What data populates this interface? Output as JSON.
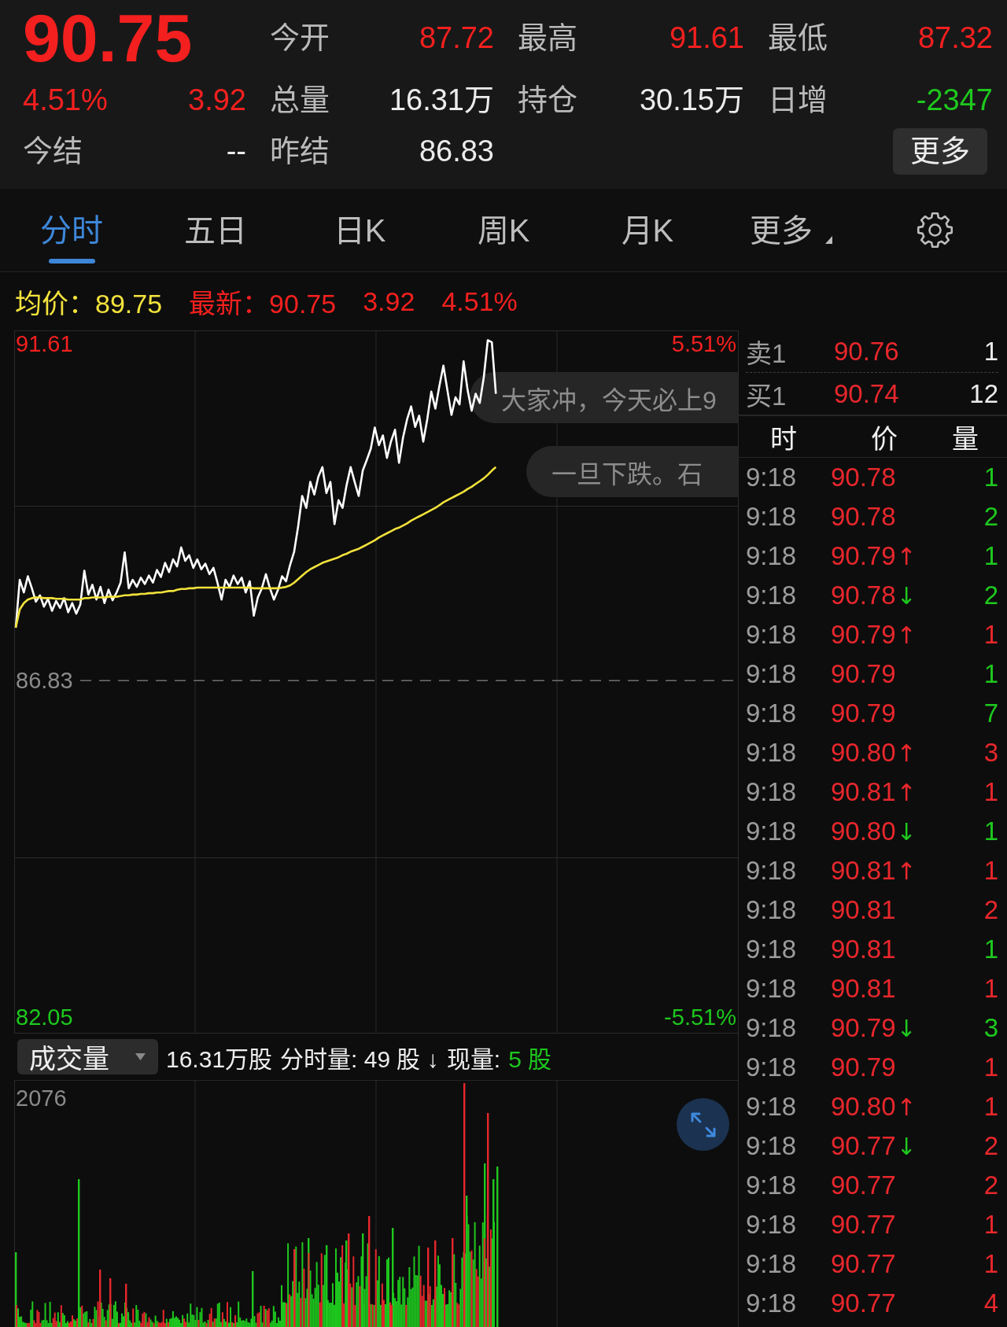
{
  "header": {
    "price": "90.75",
    "change_percent": "4.51%",
    "change": "3.92",
    "settle": {
      "label": "今结",
      "value": "--"
    },
    "stats": [
      {
        "label": "今开",
        "value": "87.72",
        "color": "#f3201f"
      },
      {
        "label": "最高",
        "value": "91.61",
        "color": "#f3201f"
      },
      {
        "label": "最低",
        "value": "87.32",
        "color": "#f3201f"
      },
      {
        "label": "总量",
        "value": "16.31万",
        "color": "#ececec"
      },
      {
        "label": "持仓",
        "value": "30.15万",
        "color": "#ececec"
      },
      {
        "label": "日增",
        "value": "-2347",
        "color": "#1ec81e"
      },
      {
        "label": "昨结",
        "value": "86.83",
        "color": "#ececec"
      }
    ],
    "more_button": "更多"
  },
  "tabs": [
    {
      "label": "分时",
      "selected": true,
      "kind": "tab"
    },
    {
      "label": "五日",
      "selected": false,
      "kind": "tab"
    },
    {
      "label": "日K",
      "selected": false,
      "kind": "tab"
    },
    {
      "label": "周K",
      "selected": false,
      "kind": "tab"
    },
    {
      "label": "月K",
      "selected": false,
      "kind": "tab"
    },
    {
      "label": "更多",
      "selected": false,
      "kind": "menu"
    }
  ],
  "legend": {
    "average": "均价：89.75",
    "latest": "最新：90.75",
    "change": "3.92",
    "change_percent": "4.51%"
  },
  "chart": {
    "percent_labels": [
      "5.51%",
      "-5.51%"
    ],
    "comments": [
      "大家冲，今天必上9",
      "一旦下跌。石"
    ],
    "chart_data": {
      "type": "line",
      "ylim": [
        81.82,
        91.8
      ],
      "yticks": [
        {
          "value": 91.61,
          "label": "91.61"
        },
        {
          "value": 82.05,
          "label": "82.05"
        }
      ],
      "ref_lines": [
        {
          "axis": "y",
          "value": 86.83,
          "label": "86.83"
        }
      ],
      "series": [
        {
          "color": "#ffffff",
          "values": [
            87.58,
            88.26,
            88.08,
            88.31,
            88.14,
            87.95,
            88.04,
            87.88,
            87.99,
            87.82,
            87.96,
            87.86,
            88.0,
            87.8,
            87.93,
            87.78,
            87.91,
            88.39,
            88.05,
            88.19,
            87.98,
            88.16,
            87.93,
            88.12,
            87.97,
            88.08,
            88.22,
            88.65,
            88.14,
            88.26,
            88.16,
            88.29,
            88.2,
            88.32,
            88.22,
            88.4,
            88.3,
            88.5,
            88.37,
            88.55,
            88.45,
            88.72,
            88.53,
            88.61,
            88.43,
            88.55,
            88.41,
            88.49,
            88.34,
            88.43,
            88.22,
            87.98,
            88.26,
            88.16,
            88.32,
            88.2,
            88.29,
            88.08,
            88.24,
            87.75,
            88.01,
            88.14,
            88.34,
            88.14,
            87.98,
            88.12,
            88.31,
            88.24,
            88.47,
            88.66,
            89.02,
            89.45,
            89.28,
            89.65,
            89.47,
            89.72,
            89.86,
            89.49,
            89.65,
            89.05,
            89.39,
            89.28,
            89.6,
            89.86,
            89.65,
            89.45,
            89.81,
            89.96,
            90.12,
            90.42,
            90.17,
            90.31,
            89.99,
            90.22,
            90.39,
            89.92,
            90.28,
            90.54,
            90.72,
            90.43,
            90.59,
            90.22,
            90.54,
            90.93,
            90.69,
            91.01,
            91.3,
            90.95,
            90.6,
            90.85,
            90.75,
            91.36,
            90.95,
            90.66,
            90.9,
            90.77,
            91.13,
            91.66,
            91.63,
            90.9,
            null,
            null,
            null,
            null,
            null,
            null,
            null,
            null,
            null,
            null,
            null,
            null,
            null,
            null,
            null,
            null,
            null,
            null,
            null,
            null,
            null,
            null,
            null,
            null,
            null,
            null,
            null,
            null,
            null,
            null,
            null,
            null,
            null,
            null,
            null,
            null,
            null,
            null,
            null,
            null,
            null,
            null,
            null,
            null,
            null,
            null,
            null,
            null,
            null,
            null,
            null,
            null,
            null,
            null,
            null,
            null,
            null,
            null,
            null,
            null
          ]
        },
        {
          "color": "#f2e23c",
          "values": [
            87.58,
            87.84,
            87.93,
            87.98,
            88.0,
            88.01,
            88.01,
            88.0,
            88.0,
            88.0,
            87.99,
            87.99,
            87.99,
            87.98,
            87.98,
            87.98,
            87.98,
            88.0,
            88.0,
            88.01,
            88.01,
            88.01,
            88.01,
            88.02,
            88.02,
            88.02,
            88.03,
            88.04,
            88.04,
            88.05,
            88.05,
            88.06,
            88.06,
            88.07,
            88.07,
            88.08,
            88.08,
            88.09,
            88.1,
            88.1,
            88.12,
            88.13,
            88.13,
            88.14,
            88.14,
            88.15,
            88.15,
            88.15,
            88.15,
            88.15,
            88.15,
            88.15,
            88.15,
            88.15,
            88.15,
            88.15,
            88.15,
            88.15,
            88.15,
            88.14,
            88.14,
            88.14,
            88.14,
            88.14,
            88.14,
            88.14,
            88.15,
            88.16,
            88.18,
            88.22,
            88.27,
            88.32,
            88.37,
            88.41,
            88.44,
            88.47,
            88.5,
            88.52,
            88.54,
            88.56,
            88.58,
            88.61,
            88.63,
            88.66,
            88.68,
            88.7,
            88.73,
            88.76,
            88.79,
            88.82,
            88.86,
            88.89,
            88.92,
            88.95,
            88.98,
            89.0,
            89.03,
            89.06,
            89.1,
            89.13,
            89.16,
            89.19,
            89.22,
            89.25,
            89.28,
            89.32,
            89.36,
            89.39,
            89.42,
            89.45,
            89.48,
            89.51,
            89.55,
            89.58,
            89.62,
            89.66,
            89.7,
            89.75,
            89.81,
            89.86,
            null,
            null,
            null,
            null,
            null,
            null,
            null,
            null,
            null,
            null,
            null,
            null,
            null,
            null,
            null,
            null,
            null,
            null,
            null,
            null,
            null,
            null,
            null,
            null,
            null,
            null,
            null,
            null,
            null,
            null,
            null,
            null,
            null,
            null,
            null,
            null,
            null,
            null,
            null,
            null,
            null,
            null,
            null,
            null,
            null,
            null,
            null,
            null,
            null,
            null,
            null,
            null,
            null,
            null,
            null,
            null,
            null,
            null,
            null,
            null
          ]
        }
      ]
    }
  },
  "volume": {
    "selector": "成交量",
    "total": "16.31万股",
    "period_volume": "分时量: 49 股 ↓",
    "current_label": "现量:",
    "current_value": "5 股",
    "max_label": "2076"
  },
  "order_book": [
    {
      "label": "卖1",
      "price": "90.76",
      "volume": "1"
    },
    {
      "label": "买1",
      "price": "90.74",
      "volume": "12"
    }
  ],
  "trades": {
    "columns": [
      "时",
      "价",
      "量"
    ],
    "rows": [
      {
        "time": "9:18",
        "price": "90.78",
        "volume": "1",
        "color": "#1ec81e"
      },
      {
        "time": "9:18",
        "price": "90.78",
        "volume": "2",
        "color": "#1ec81e"
      },
      {
        "time": "9:18",
        "price": "90.79",
        "arrow": {
          "symbol": "↑",
          "color": "#e8272c"
        },
        "volume": "1",
        "color": "#1ec81e"
      },
      {
        "time": "9:18",
        "price": "90.78",
        "arrow": {
          "symbol": "↓",
          "color": "#1ec81e"
        },
        "volume": "2",
        "color": "#1ec81e"
      },
      {
        "time": "9:18",
        "price": "90.79",
        "arrow": {
          "symbol": "↑",
          "color": "#e8272c"
        },
        "volume": "1",
        "color": "#e8272c"
      },
      {
        "time": "9:18",
        "price": "90.79",
        "volume": "1",
        "color": "#1ec81e"
      },
      {
        "time": "9:18",
        "price": "90.79",
        "volume": "7",
        "color": "#1ec81e"
      },
      {
        "time": "9:18",
        "price": "90.80",
        "arrow": {
          "symbol": "↑",
          "color": "#e8272c"
        },
        "volume": "3",
        "color": "#e8272c"
      },
      {
        "time": "9:18",
        "price": "90.81",
        "arrow": {
          "symbol": "↑",
          "color": "#e8272c"
        },
        "volume": "1",
        "color": "#e8272c"
      },
      {
        "time": "9:18",
        "price": "90.80",
        "arrow": {
          "symbol": "↓",
          "color": "#1ec81e"
        },
        "volume": "1",
        "color": "#1ec81e"
      },
      {
        "time": "9:18",
        "price": "90.81",
        "arrow": {
          "symbol": "↑",
          "color": "#e8272c"
        },
        "volume": "1",
        "color": "#e8272c"
      },
      {
        "time": "9:18",
        "price": "90.81",
        "volume": "2",
        "color": "#e8272c"
      },
      {
        "time": "9:18",
        "price": "90.81",
        "volume": "1",
        "color": "#1ec81e"
      },
      {
        "time": "9:18",
        "price": "90.81",
        "volume": "1",
        "color": "#e8272c"
      },
      {
        "time": "9:18",
        "price": "90.79",
        "arrow": {
          "symbol": "↓",
          "color": "#1ec81e"
        },
        "volume": "3",
        "color": "#1ec81e"
      },
      {
        "time": "9:18",
        "price": "90.79",
        "volume": "1",
        "color": "#e8272c"
      },
      {
        "time": "9:18",
        "price": "90.80",
        "arrow": {
          "symbol": "↑",
          "color": "#e8272c"
        },
        "volume": "1",
        "color": "#e8272c"
      },
      {
        "time": "9:18",
        "price": "90.77",
        "arrow": {
          "symbol": "↓",
          "color": "#1ec81e"
        },
        "volume": "2",
        "color": "#e8272c"
      },
      {
        "time": "9:18",
        "price": "90.77",
        "volume": "2",
        "color": "#e8272c"
      },
      {
        "time": "9:18",
        "price": "90.77",
        "volume": "1",
        "color": "#e8272c"
      },
      {
        "time": "9:18",
        "price": "90.77",
        "volume": "1",
        "color": "#e8272c"
      },
      {
        "time": "9:18",
        "price": "90.77",
        "volume": "4",
        "color": "#e8272c"
      }
    ]
  }
}
